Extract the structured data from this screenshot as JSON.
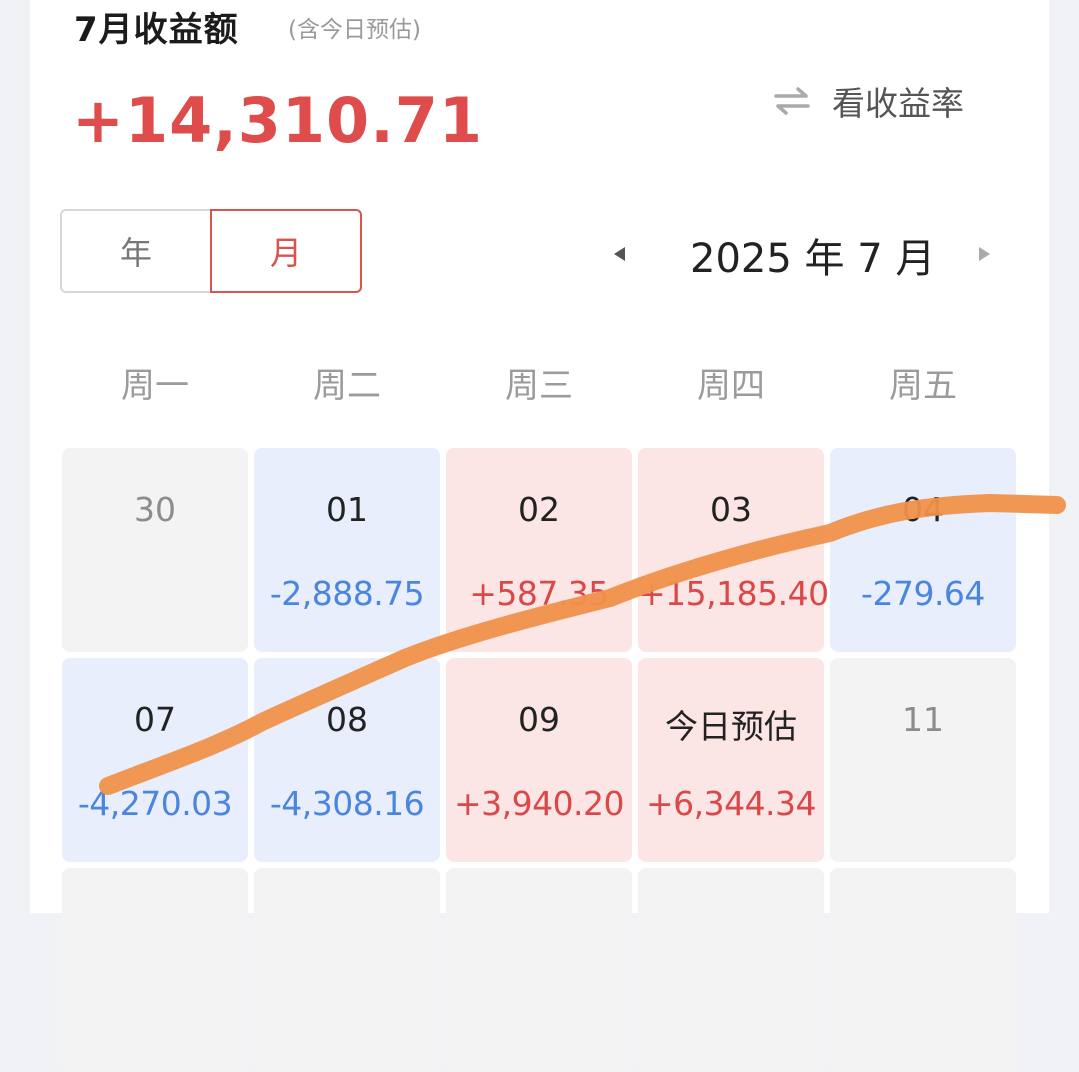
{
  "header": {
    "title": "7月收益额",
    "subtitle": "(含今日预估)",
    "total": "+14,310.71",
    "switch_label": "看收益率"
  },
  "toggle": {
    "year": "年",
    "month": "月",
    "selected": "月"
  },
  "nav": {
    "current": "2025 年 7 月"
  },
  "weekdays": [
    "周一",
    "周二",
    "周三",
    "周四",
    "周五"
  ],
  "rows": [
    [
      {
        "day": "30",
        "value": "",
        "state": "neutral"
      },
      {
        "day": "01",
        "value": "-2,888.75",
        "state": "loss"
      },
      {
        "day": "02",
        "value": "+587.35",
        "state": "gain"
      },
      {
        "day": "03",
        "value": "+15,185.40",
        "state": "gain"
      },
      {
        "day": "04",
        "value": "-279.64",
        "state": "loss"
      }
    ],
    [
      {
        "day": "07",
        "value": "-4,270.03",
        "state": "loss"
      },
      {
        "day": "08",
        "value": "-4,308.16",
        "state": "loss"
      },
      {
        "day": "09",
        "value": "+3,940.20",
        "state": "gain"
      },
      {
        "day": "今日预估",
        "value": "+6,344.34",
        "state": "gain"
      },
      {
        "day": "11",
        "value": "",
        "state": "neutral"
      }
    ]
  ],
  "colors": {
    "gain": "#da4848",
    "loss": "#4a86e0",
    "accent": "#d9534f",
    "annotation": "#f0914a"
  },
  "icons": {
    "switch": "swap-arrows-icon",
    "prev": "triangle-left-icon",
    "next": "triangle-right-icon"
  }
}
